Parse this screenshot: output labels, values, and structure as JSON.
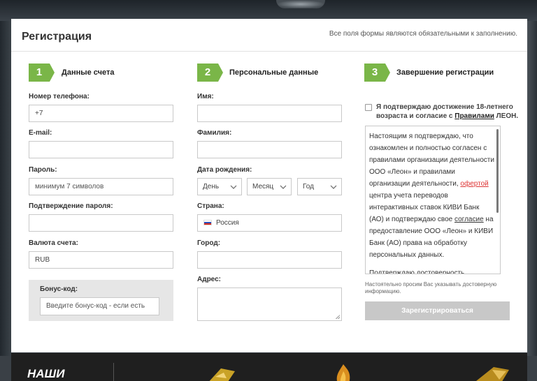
{
  "header": {
    "title": "Регистрация",
    "note": "Все поля формы являются обязательными к заполнению."
  },
  "steps": [
    {
      "num": "1",
      "label": "Данные счета"
    },
    {
      "num": "2",
      "label": "Персональные данные"
    },
    {
      "num": "3",
      "label": "Завершение регистрации"
    }
  ],
  "account": {
    "phone_label": "Номер телефона:",
    "phone_value": "+7",
    "email_label": "E-mail:",
    "email_value": "",
    "password_label": "Пароль:",
    "password_placeholder": "минимум 7 символов",
    "confirm_label": "Подтверждение пароля:",
    "confirm_value": "",
    "currency_label": "Валюта счета:",
    "currency_value": "RUB",
    "bonus_label": "Бонус-код:",
    "bonus_placeholder": "Введите бонус-код - если есть"
  },
  "personal": {
    "name_label": "Имя:",
    "surname_label": "Фамилия:",
    "dob_label": "Дата рождения:",
    "day": "День",
    "month": "Месяц",
    "year": "Год",
    "country_label": "Страна:",
    "country_value": "Россия",
    "city_label": "Город:",
    "address_label": "Адрес:"
  },
  "finish": {
    "agree_prefix": "Я подтверждаю достижение 18-летнего возраста и согласие с ",
    "agree_link": "Правилами",
    "agree_suffix": " ЛЕОН.",
    "terms_p1_a": "Настоящим я подтверждаю, что ознакомлен и полностью согласен с правилами организации деятельности ООО «Леон» и правилами организации деятельности, ",
    "terms_p1_link": "офертой",
    "terms_p1_b": " центра учета переводов интерактивных ставок КИВИ Банк (АО) и подтверждаю свое ",
    "terms_p1_link2": "согласие",
    "terms_p1_c": " на предоставление ООО «Леон» и КИВИ Банк (АО) права на обработку персональных данных.",
    "terms_p2": "Подтверждаю достоверность указанных мной персональных данных.",
    "note": "Настоятельно просим Вас указывать достоверную информацию.",
    "register_button": "Зарегистрироваться"
  },
  "footer": {
    "title": "НАШИ"
  },
  "colors": {
    "accent_green": "#7ab648",
    "button_disabled": "#c8c8c8",
    "link_red": "#d33333"
  }
}
